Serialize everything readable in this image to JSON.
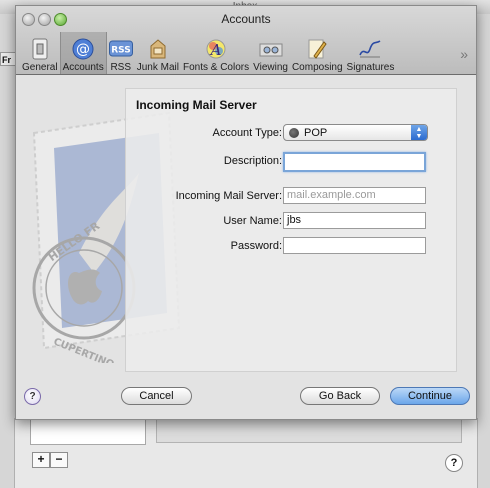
{
  "background": {
    "title": "Inbox",
    "toolbar_stub": "Fr"
  },
  "window": {
    "title": "Accounts"
  },
  "toolbar": {
    "items": [
      {
        "label": "General",
        "icon": "switch-icon"
      },
      {
        "label": "Accounts",
        "icon": "at-icon"
      },
      {
        "label": "RSS",
        "icon": "rss-icon"
      },
      {
        "label": "Junk Mail",
        "icon": "junk-mail-icon"
      },
      {
        "label": "Fonts & Colors",
        "icon": "fonts-icon"
      },
      {
        "label": "Viewing",
        "icon": "glasses-icon"
      },
      {
        "label": "Composing",
        "icon": "pencil-icon"
      },
      {
        "label": "Signatures",
        "icon": "signature-icon"
      }
    ],
    "selected": "Accounts",
    "overflow": "»"
  },
  "form": {
    "section_title": "Incoming Mail Server",
    "account_type": {
      "label": "Account Type:",
      "value": "POP"
    },
    "description": {
      "label": "Description:",
      "value": ""
    },
    "incoming_server": {
      "label": "Incoming Mail Server:",
      "placeholder": "mail.example.com",
      "value": ""
    },
    "user_name": {
      "label": "User Name:",
      "value": "jbs"
    },
    "password": {
      "label": "Password:",
      "value": ""
    }
  },
  "stamp_text": {
    "top": "HELLO FR",
    "bottom": "CUPERTINO CA"
  },
  "buttons": {
    "help": "?",
    "cancel": "Cancel",
    "go_back": "Go Back",
    "continue": "Continue"
  },
  "bottom": {
    "add": "+",
    "remove": "−",
    "help": "?"
  }
}
